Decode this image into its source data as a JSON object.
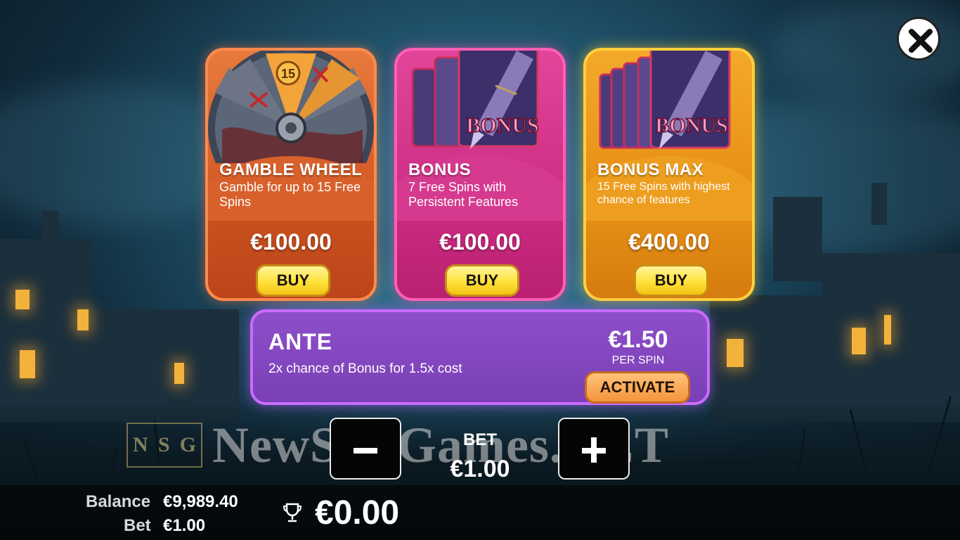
{
  "colors": {
    "gamble_card": "#d65a26",
    "bonus_card": "#cf2f86",
    "bonus_max_card": "#e88f15",
    "ante_panel": "#7a3fb5",
    "buy_button": "#ffe23a",
    "activate_button": "#f5953a"
  },
  "close_button": {
    "icon": "close-icon"
  },
  "cards": [
    {
      "title": "GAMBLE WHEEL",
      "description": "Gamble for up to 15 Free Spins",
      "price": "€100.00",
      "button": "BUY",
      "art_number": "15"
    },
    {
      "title": "BONUS",
      "description": "7 Free Spins with Persistent Features",
      "price": "€100.00",
      "button": "BUY",
      "art_text": "BONUS"
    },
    {
      "title": "BONUS MAX",
      "description": "15 Free Spins with highest chance of features",
      "price": "€400.00",
      "button": "BUY",
      "art_text": "BONUS"
    }
  ],
  "ante": {
    "title": "ANTE",
    "description": "2x chance of Bonus for 1.5x cost",
    "price": "€1.50",
    "price_suffix": "PER SPIN",
    "button": "ACTIVATE"
  },
  "watermark": {
    "logo_letters": [
      "N",
      "S",
      "G"
    ],
    "text": "NewSlotGames.NET"
  },
  "bet_control": {
    "label": "BET",
    "value": "€1.00",
    "minus_icon": "minus-icon",
    "plus_icon": "plus-icon"
  },
  "footer": {
    "balance_label": "Balance",
    "balance_value": "€9,989.40",
    "bet_label": "Bet",
    "bet_value": "€1.00",
    "win_icon": "trophy-icon",
    "win_value": "€0.00"
  }
}
